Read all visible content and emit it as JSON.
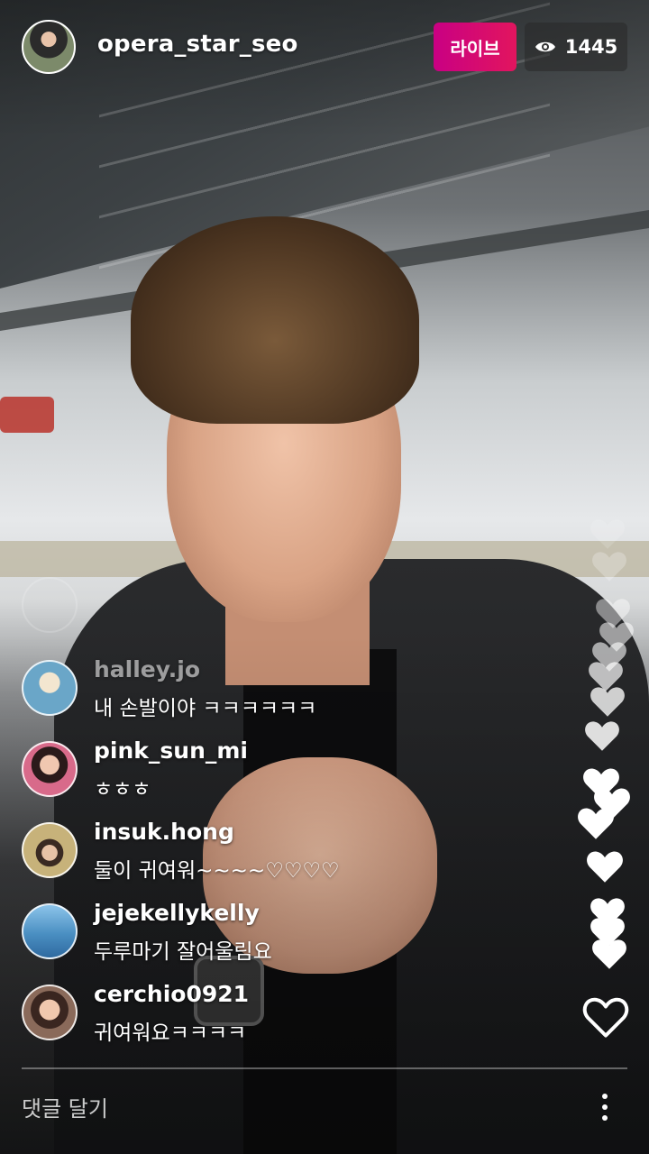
{
  "header": {
    "host_username": "opera_star_seo",
    "live_label": "라이브",
    "viewer_count": "1445",
    "viewer_icon": "eye-icon"
  },
  "comments": [
    {
      "username": "halley.jo",
      "text": "내 손발이야 ㅋㅋㅋㅋㅋㅋ",
      "avatar_color": "#6aa6c8"
    },
    {
      "username": "pink_sun_mi",
      "text": "ㅎㅎㅎ",
      "avatar_color": "#d86a8a"
    },
    {
      "username": "insuk.hong",
      "text": "둘이 귀여워~~~~♡♡♡♡",
      "avatar_color": "#c7b27a"
    },
    {
      "username": "jejekellykelly",
      "text": "두루마기 잘어울림요",
      "avatar_color": "#4a8fc2"
    },
    {
      "username": "cerchio0921",
      "text": "귀여워요ㅋㅋㅋㅋ",
      "avatar_color": "#8a6a5a"
    }
  ],
  "footer": {
    "comment_placeholder": "댓글 달기",
    "more_icon": "more-options-icon",
    "like_icon": "heart-outline-icon"
  },
  "colors": {
    "live_gradient_start": "#c90083",
    "live_gradient_end": "#e2155e",
    "text": "#ffffff"
  }
}
